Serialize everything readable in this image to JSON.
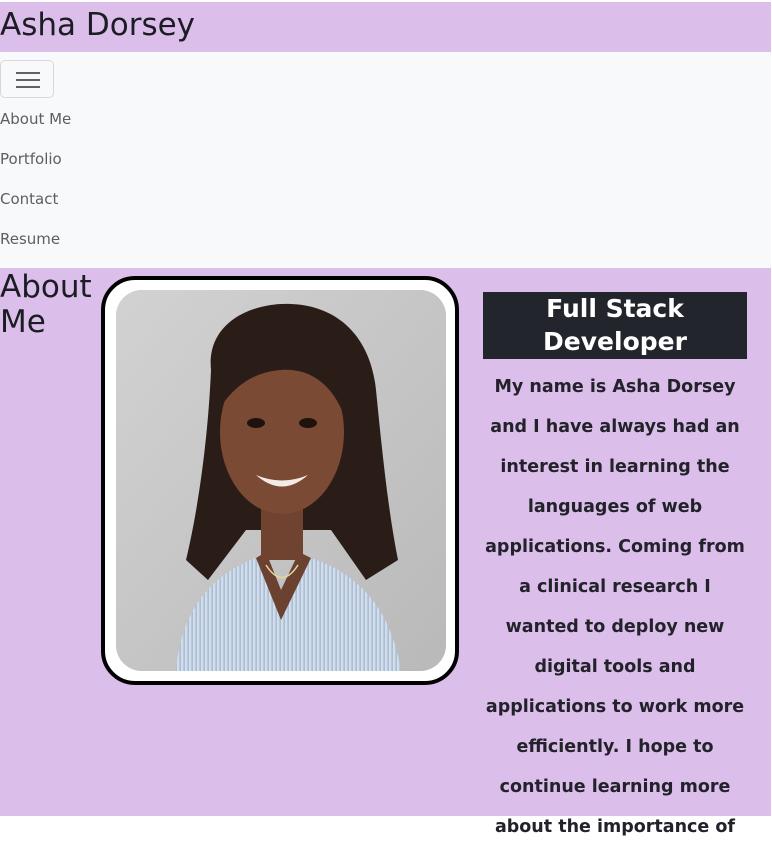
{
  "header": {
    "title": "Asha Dorsey"
  },
  "nav": {
    "toggle_icon": "hamburger-menu-icon",
    "items": [
      {
        "label": "About Me"
      },
      {
        "label": "Portfolio"
      },
      {
        "label": "Contact"
      },
      {
        "label": "Resume"
      }
    ]
  },
  "about": {
    "heading": "About Me",
    "role": "Full Stack Developer",
    "bio": "My name is Asha Dorsey and I have always had an interest in learning the languages of web applications. Coming from a clinical research I wanted to deploy new digital tools and applications to work more efficiently. I hope to continue learning more about the importance of"
  },
  "colors": {
    "accent": "#dcbeeb",
    "navbar_bg": "#f8f9fa",
    "badge_bg": "#22262c",
    "text": "#1c1c24"
  }
}
